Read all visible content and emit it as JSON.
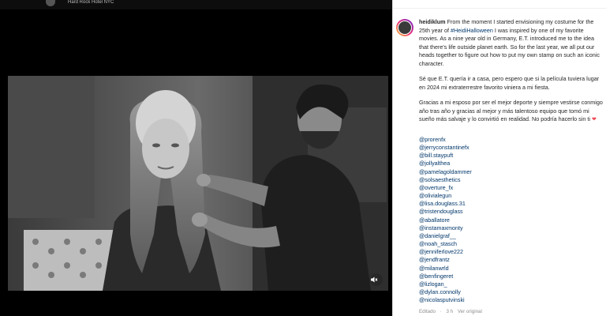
{
  "header": {
    "location": "Hard Rock Hotel NYC"
  },
  "video": {
    "mute_icon": "speaker-muted-icon"
  },
  "post": {
    "username": "heidiklum",
    "caption_intro": "From the moment I started envisioning my costume for the 25th year of",
    "hashtag": "#HeidiHalloween",
    "caption_rest": "I was inspired by one of my favorite movies. As a nine year old in Germany, E.T. introduced me to the idea that there's life outside planet earth. So for the last year, we all put our heads together to figure out how to put my own stamp on such an iconic character.",
    "paragraph2": "Sé que E.T. quería ir a casa, pero espero que si la película tuviera lugar en 2024 mi extraterrestre favorito viniera a mi fiesta.",
    "paragraph3": "Gracias a mi esposo por ser el mejor deporte y siempre vestirse conmigo año tras año y gracias al mejor y más talentoso equipo que tomó mi sueño más salvaje y lo convirtió en realidad. No podría hacerlo sin ti",
    "heart": "❤",
    "mentions": [
      "@prorenfx",
      "@jerryconstantinefx",
      "@bill.staypuft",
      "@jollyalthea",
      "@pamelagoldammer",
      "@solsaesthetics",
      "@overture_fx",
      "@olivialegun",
      "@lisa.douglass.31",
      "@tristendouglass",
      "@aballatore",
      "@instamaxmonty",
      "@danielgraf__",
      "@noah_stasch",
      "@jenniferlove222",
      "@jendfrantz",
      "@milanwrld",
      "@benfingeret",
      "@lizlogan_",
      "@dylan.connolly",
      "@nicolasputvinski"
    ],
    "edited": "Editado",
    "time": "3 h",
    "see_original": "Ver original"
  }
}
